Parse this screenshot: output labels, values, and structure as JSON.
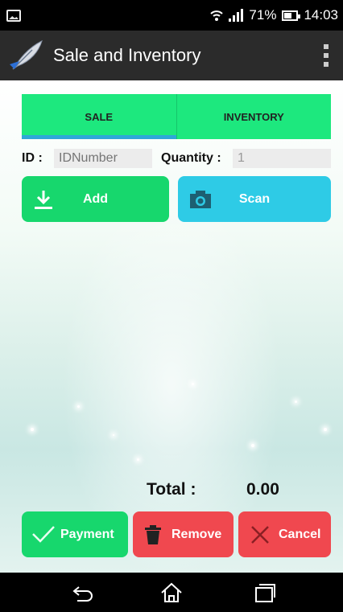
{
  "status_bar": {
    "battery_percent": "71%",
    "time": "14:03",
    "icons": [
      "gallery-icon",
      "wifi-icon",
      "signal-icon",
      "battery-icon"
    ]
  },
  "app_bar": {
    "title": "Sale and Inventory",
    "logo_icon": "feather-logo-icon",
    "menu_icon": "overflow-menu-icon"
  },
  "tabs": [
    {
      "label": "SALE",
      "active": true
    },
    {
      "label": "INVENTORY",
      "active": false
    }
  ],
  "form": {
    "id_label": "ID :",
    "id_value": "",
    "id_placeholder": "IDNumber",
    "quantity_label": "Quantity :",
    "quantity_value": "1"
  },
  "actions": {
    "add_label": "Add",
    "add_icon": "download-icon",
    "scan_label": "Scan",
    "scan_icon": "camera-icon"
  },
  "total": {
    "label": "Total :",
    "value": "0.00"
  },
  "bottom_actions": {
    "payment_label": "Payment",
    "payment_icon": "check-icon",
    "remove_label": "Remove",
    "remove_icon": "trash-icon",
    "cancel_label": "Cancel",
    "cancel_icon": "close-icon"
  },
  "nav_bar": {
    "icons": [
      "back-icon",
      "home-icon",
      "recent-apps-icon"
    ]
  },
  "colors": {
    "accent_green": "#17d76d",
    "tab_green": "#1de87e",
    "accent_cyan": "#2ecbe6",
    "danger_red": "#f0484f",
    "tab_indicator": "#2fa7d8"
  }
}
